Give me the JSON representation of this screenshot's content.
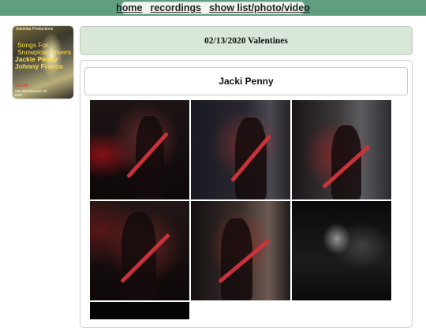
{
  "nav": {
    "links": [
      "home",
      "recordings",
      "show list/photo/video"
    ]
  },
  "poster": {
    "org": "Sdsimba Productions",
    "title": "Songs For\nSnowplow Drivers",
    "names": "Jackie Penny\nJohnny Franco",
    "date": "2/13/20",
    "address": "532 SW Morrison St\n8:00"
  },
  "header": {
    "title": "02/13/2020 Valentines"
  },
  "artist": {
    "name": "Jacki Penny"
  },
  "photos": [
    {
      "name": "concert-photo-1"
    },
    {
      "name": "concert-photo-2"
    },
    {
      "name": "concert-photo-3"
    },
    {
      "name": "concert-photo-4"
    },
    {
      "name": "concert-photo-5"
    },
    {
      "name": "concert-photo-6"
    },
    {
      "name": "concert-photo-7"
    }
  ],
  "colors": {
    "nav_bar": "#5f9e7f",
    "header_bg": "#d8e7d8",
    "guitar_red": "#c8323a"
  }
}
